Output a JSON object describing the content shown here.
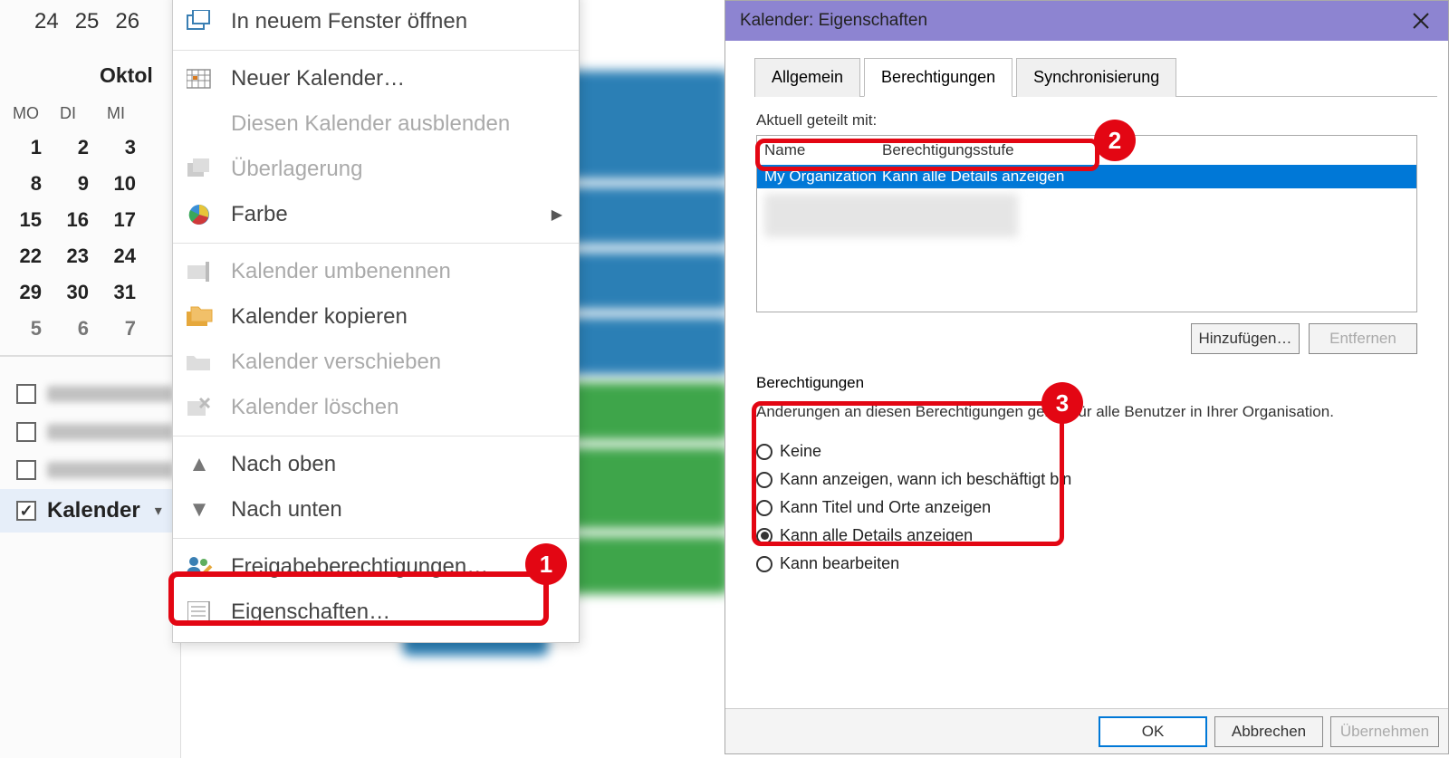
{
  "mini": {
    "top_dates": [
      "24",
      "25",
      "26"
    ],
    "month_label": "Oktol",
    "dow": [
      "MO",
      "DI",
      "MI"
    ],
    "weeks": [
      [
        "1",
        "2",
        "3"
      ],
      [
        "8",
        "9",
        "10"
      ],
      [
        "15",
        "16",
        "17"
      ],
      [
        "22",
        "23",
        "24"
      ],
      [
        "29",
        "30",
        "31"
      ],
      [
        "5",
        "6",
        "7"
      ]
    ],
    "kalender_label": "Kalender"
  },
  "ctx": {
    "open_new": "In neuem Fenster öffnen",
    "new_cal": "Neuer Kalender…",
    "hide_cal": "Diesen Kalender ausblenden",
    "overlay": "Überlagerung",
    "color": "Farbe",
    "rename": "Kalender umbenennen",
    "copy": "Kalender kopieren",
    "move": "Kalender verschieben",
    "delete": "Kalender löschen",
    "up": "Nach oben",
    "down": "Nach unten",
    "share_perm": "Freigabeberechtigungen…",
    "props": "Eigenschaften…"
  },
  "dialog": {
    "title": "Kalender: Eigenschaften",
    "tabs": {
      "general": "Allgemein",
      "perm": "Berechtigungen",
      "sync": "Synchronisierung"
    },
    "shared_label": "Aktuell geteilt mit:",
    "cols": {
      "name": "Name",
      "level": "Berechtigungsstufe"
    },
    "row_name": "My Organization",
    "row_level": "Kann alle Details anzeigen",
    "add_btn": "Hinzufügen…",
    "remove_btn": "Entfernen",
    "perm_title": "Berechtigungen",
    "perm_note": "Änderungen an diesen Berechtigungen gelten für alle Benutzer in Ihrer Organisation.",
    "radios": {
      "none": "Keine",
      "busy": "Kann anzeigen, wann ich beschäftigt bin",
      "titles": "Kann Titel und Orte anzeigen",
      "details": "Kann alle Details anzeigen",
      "edit": "Kann bearbeiten"
    },
    "ok": "OK",
    "cancel": "Abbrechen",
    "apply": "Übernehmen"
  },
  "callouts": {
    "c1": "1",
    "c2": "2",
    "c3": "3"
  }
}
